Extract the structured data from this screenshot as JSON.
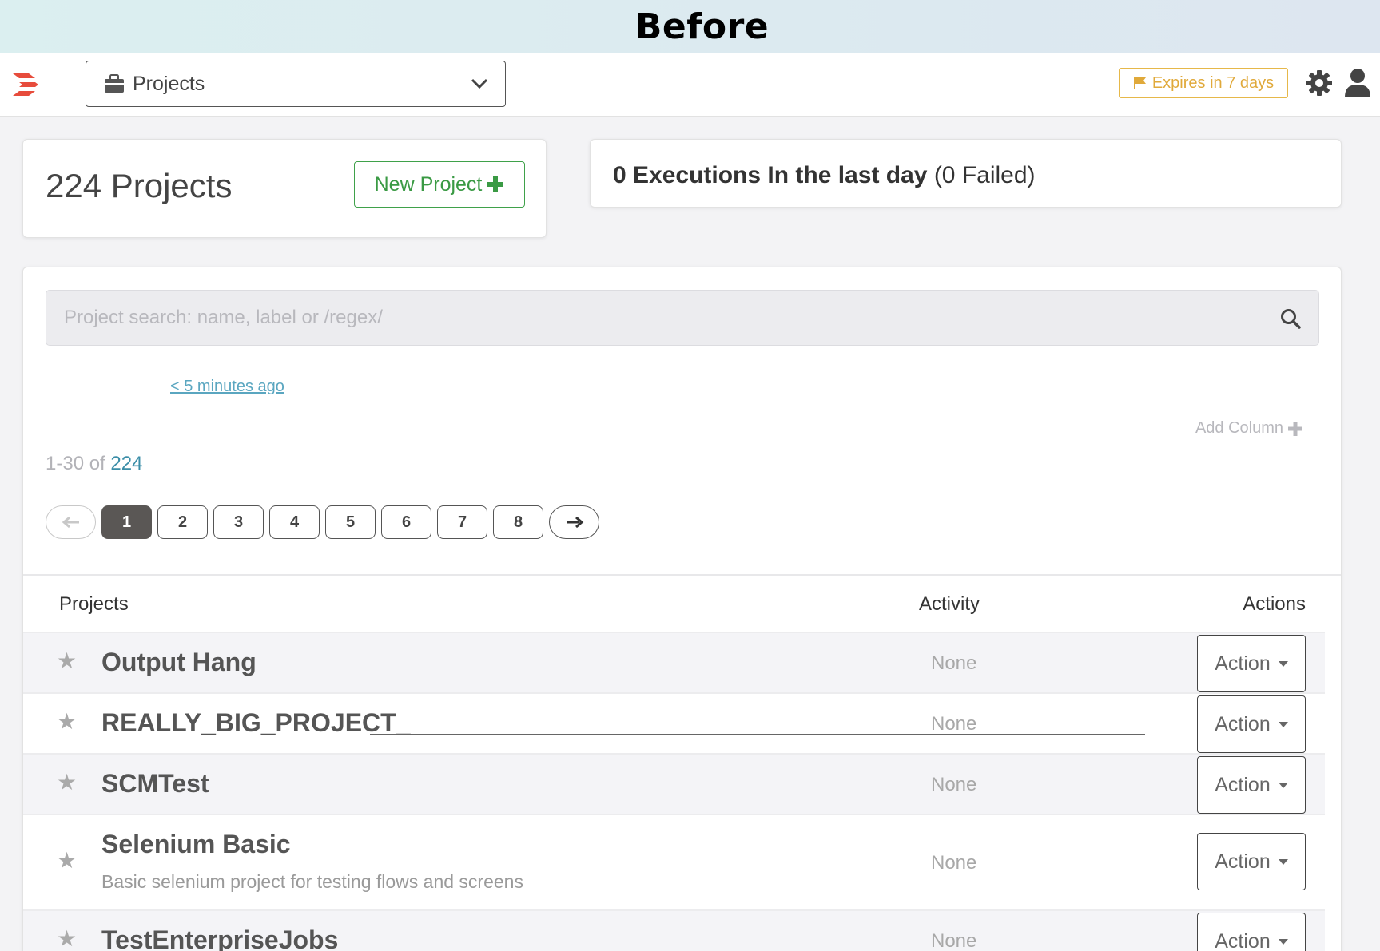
{
  "banner": {
    "title": "Before"
  },
  "topbar": {
    "project_selector": {
      "label": "Projects"
    },
    "expires_label": "Expires in 7 days",
    "colors": {
      "logo": "#e74c3c",
      "expires": "#e0a93a"
    }
  },
  "summary": {
    "project_count_label": "224 Projects",
    "new_project_label": "New Project",
    "executions_label": "0 Executions In the last day",
    "failed_label": "(0 Failed)"
  },
  "search": {
    "placeholder": "Project search: name, label or /regex/"
  },
  "recent_label": "< 5 minutes ago",
  "add_column_label": "Add Column",
  "range": {
    "prefix": "1-30 of ",
    "total": "224"
  },
  "pagination": {
    "pages": [
      "1",
      "2",
      "3",
      "4",
      "5",
      "6",
      "7",
      "8"
    ],
    "current": "1"
  },
  "table": {
    "headers": {
      "projects": "Projects",
      "activity": "Activity",
      "actions": "Actions"
    },
    "rows": [
      {
        "name": "Output Hang",
        "description": "",
        "activity": "None",
        "action": "Action"
      },
      {
        "name": "REALLY_BIG_PROJECT_",
        "description": "",
        "activity": "None",
        "action": "Action"
      },
      {
        "name": "SCMTest",
        "description": "",
        "activity": "None",
        "action": "Action"
      },
      {
        "name": "Selenium Basic",
        "description": "Basic selenium project for testing flows and screens",
        "activity": "None",
        "action": "Action"
      },
      {
        "name": "TestEnterpriseJobs",
        "description": "",
        "activity": "None",
        "action": "Action"
      }
    ]
  }
}
